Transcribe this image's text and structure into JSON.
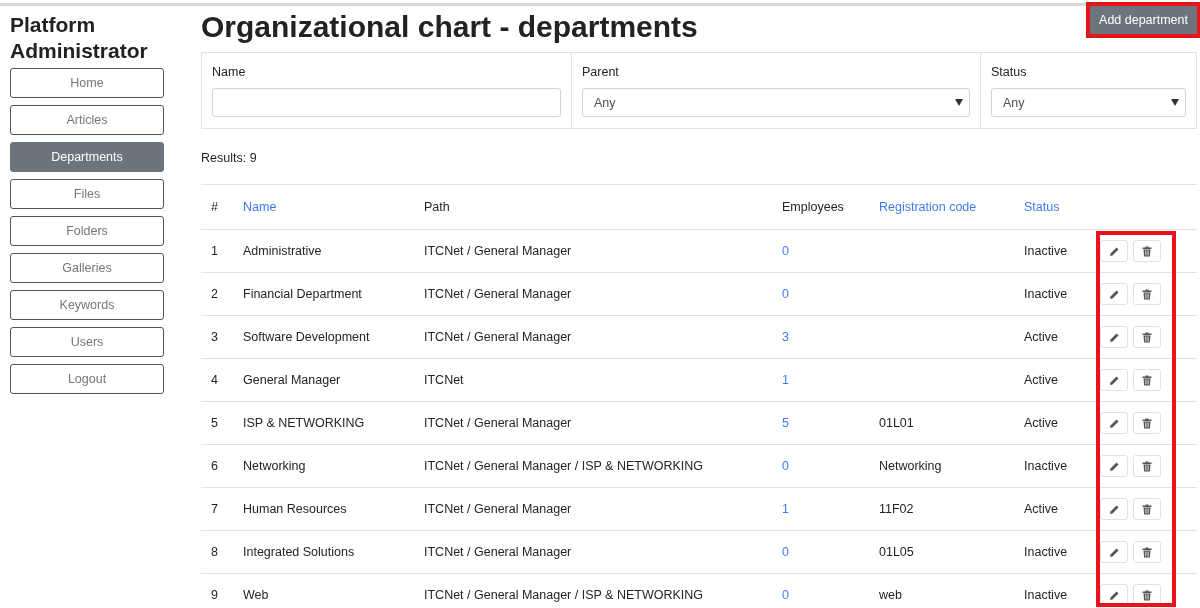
{
  "sidebar": {
    "title_lines": [
      "Platform",
      "Administrator"
    ],
    "items": [
      {
        "label": "Home",
        "selected": false
      },
      {
        "label": "Articles",
        "selected": false
      },
      {
        "label": "Departments",
        "selected": true
      },
      {
        "label": "Files",
        "selected": false
      },
      {
        "label": "Folders",
        "selected": false
      },
      {
        "label": "Galleries",
        "selected": false
      },
      {
        "label": "Keywords",
        "selected": false
      },
      {
        "label": "Users",
        "selected": false
      },
      {
        "label": "Logout",
        "selected": false
      }
    ]
  },
  "page_title": "Organizational chart - departments",
  "add_button": {
    "label": "Add department",
    "highlighted": true
  },
  "filters": [
    {
      "kind": "text",
      "label": "Name"
    },
    {
      "kind": "select",
      "label": "Parent",
      "value": "Any"
    },
    {
      "kind": "select",
      "label": "Status",
      "value": "Any"
    }
  ],
  "results": "Results: 9",
  "table": {
    "columns": [
      {
        "label": "#",
        "sortable": false
      },
      {
        "label": "Name",
        "sortable": true
      },
      {
        "label": "Path",
        "sortable": false
      },
      {
        "label": "Employees",
        "sortable": false
      },
      {
        "label": "Registration code",
        "sortable": true
      },
      {
        "label": "Status",
        "sortable": true
      }
    ],
    "actions_highlighted": true,
    "rows": [
      {
        "num": "1",
        "name": "Administrative",
        "path": "ITCNet / General Manager",
        "employees": "0",
        "code": "",
        "status": "Inactive"
      },
      {
        "num": "2",
        "name": "Financial Department",
        "path": "ITCNet / General Manager",
        "employees": "0",
        "code": "",
        "status": "Inactive"
      },
      {
        "num": "3",
        "name": "Software Development",
        "path": "ITCNet / General Manager",
        "employees": "3",
        "code": "",
        "status": "Active"
      },
      {
        "num": "4",
        "name": "General Manager",
        "path": "ITCNet",
        "employees": "1",
        "code": "",
        "status": "Active"
      },
      {
        "num": "5",
        "name": "ISP & NETWORKING",
        "path": "ITCNet / General Manager",
        "employees": "5",
        "code": "01L01",
        "status": "Active"
      },
      {
        "num": "6",
        "name": "Networking",
        "path": "ITCNet / General Manager / ISP & NETWORKING",
        "employees": "0",
        "code": "Networking",
        "status": "Inactive"
      },
      {
        "num": "7",
        "name": "Human Resources",
        "path": "ITCNet / General Manager",
        "employees": "1",
        "code": "11F02",
        "status": "Active"
      },
      {
        "num": "8",
        "name": "Integrated Solutions",
        "path": "ITCNet / General Manager",
        "employees": "0",
        "code": "01L05",
        "status": "Inactive"
      },
      {
        "num": "9",
        "name": "Web",
        "path": "ITCNet / General Manager / ISP & NETWORKING",
        "employees": "0",
        "code": "web",
        "status": "Inactive"
      }
    ]
  }
}
